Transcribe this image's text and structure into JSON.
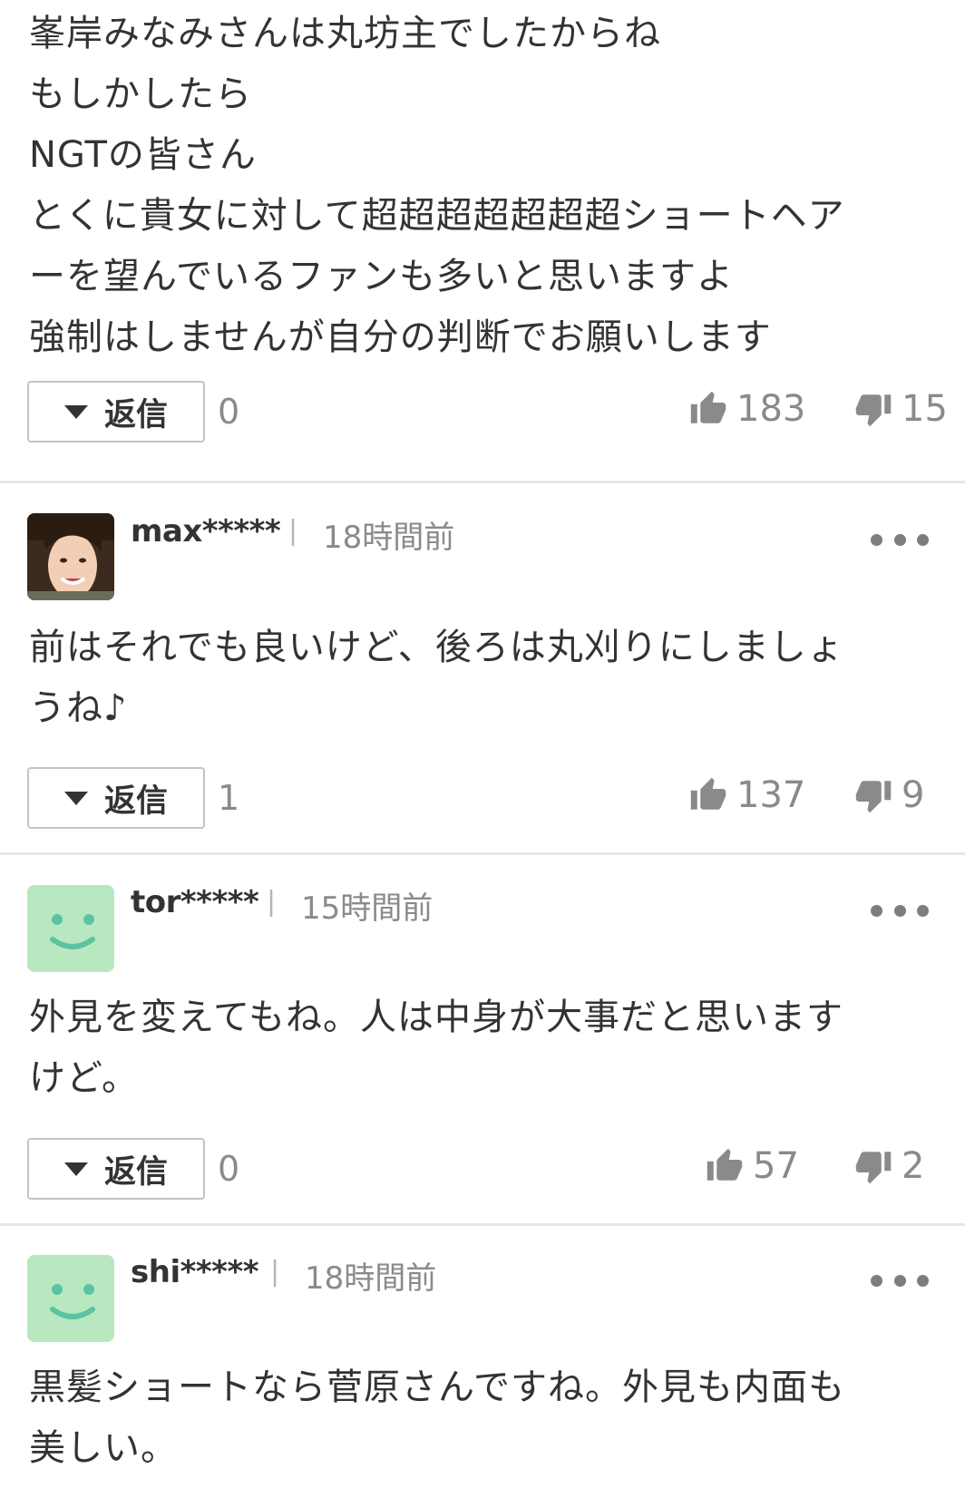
{
  "comments": [
    {
      "body_lines": [
        "峯岸みなみさんは丸坊主でしたからね",
        "もしかしたら",
        "NGTの皆さん",
        "とくに貴女に対して超超超超超超超ショートヘア",
        "ーを望んでいるファンも多いと思いますよ",
        "強制はしませんが自分の判断でお願いします"
      ],
      "reply_label": "返信",
      "reply_count": "0",
      "likes": "183",
      "dislikes": "15"
    },
    {
      "username": "max*****",
      "separator": "|",
      "time": "18時間前",
      "avatar": "photo",
      "body_lines": [
        "前はそれでも良いけど、後ろは丸刈りにしましょ",
        "うね♪"
      ],
      "reply_label": "返信",
      "reply_count": "1",
      "likes": "137",
      "dislikes": "9"
    },
    {
      "username": "tor*****",
      "separator": "|",
      "time": "15時間前",
      "avatar": "smiley-icon",
      "body_lines": [
        "外見を変えてもね。人は中身が大事だと思います",
        "けど。"
      ],
      "reply_label": "返信",
      "reply_count": "0",
      "likes": "57",
      "dislikes": "2"
    },
    {
      "username": "shi*****",
      "separator": "|",
      "time": "18時間前",
      "avatar": "smiley-icon",
      "body_lines": [
        "黒髪ショートなら菅原さんですね。外見も内面も",
        "美しい。"
      ]
    }
  ],
  "colors": {
    "avatar_bg": "#b9e8c0",
    "smiley_stroke": "#5cc3a0",
    "vote_icon": "#8a8a8a",
    "text": "#333333",
    "muted": "#8a8a8a",
    "divider": "#e6e6e6"
  },
  "icons": {
    "like": "thumbs-up-icon",
    "dislike": "thumbs-down-icon",
    "more": "more-options-icon",
    "reply_toggle": "triangle-down-icon"
  }
}
